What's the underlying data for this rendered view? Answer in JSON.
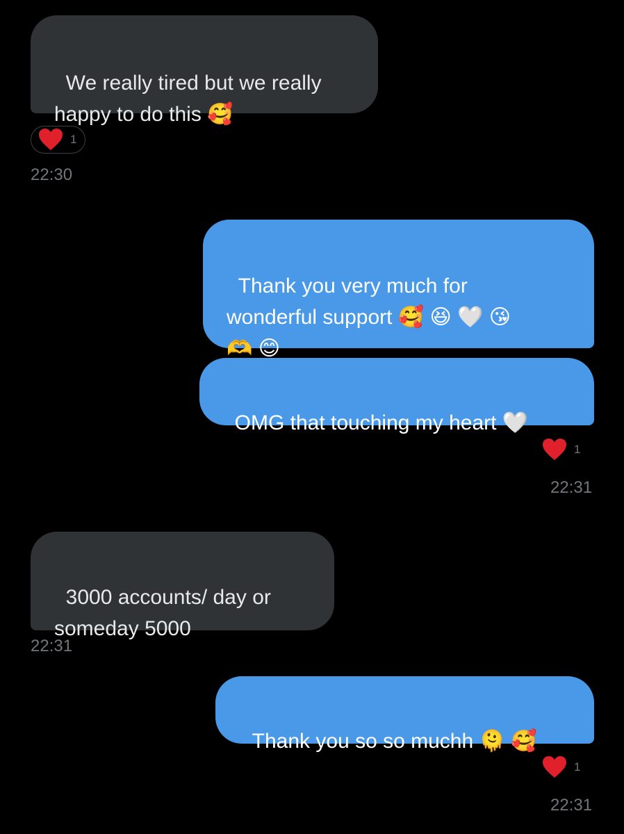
{
  "colors": {
    "background": "#000000",
    "incoming_bubble": "#2f3336",
    "outgoing_bubble": "#4a99e9",
    "timestamp": "#71767b",
    "reaction_heart": "#e0212b"
  },
  "messages": [
    {
      "direction": "incoming",
      "text": "We really tired but we really\nhappy to do this 🥰",
      "reaction": {
        "icon": "red-heart-icon",
        "count": "1"
      },
      "time": "22:30"
    },
    {
      "direction": "outgoing",
      "text": "Thank you very much for\nwonderful support 🥰 😆 🤍 😘\n🫶 😊"
    },
    {
      "direction": "outgoing",
      "text": "OMG that touching my heart 🤍",
      "reaction": {
        "icon": "red-heart-icon",
        "count": "1"
      },
      "time": "22:31"
    },
    {
      "direction": "incoming",
      "text": "3000 accounts/ day or\nsomeday 5000",
      "time": "22:31"
    },
    {
      "direction": "outgoing",
      "text": "Thank you so so muchh 🫠 🥰",
      "reaction": {
        "icon": "red-heart-icon",
        "count": "1"
      },
      "time": "22:31"
    }
  ]
}
